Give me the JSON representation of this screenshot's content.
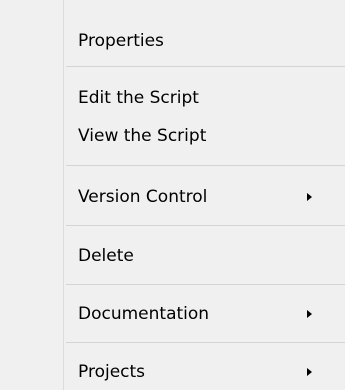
{
  "menu": {
    "items": [
      {
        "label": "Properties",
        "has_submenu": false
      },
      {
        "label": "Edit the Script",
        "has_submenu": false
      },
      {
        "label": "View the Script",
        "has_submenu": false
      },
      {
        "label": "Version Control",
        "has_submenu": true
      },
      {
        "label": "Delete",
        "has_submenu": false
      },
      {
        "label": "Documentation",
        "has_submenu": true
      },
      {
        "label": "Projects",
        "has_submenu": true
      }
    ]
  },
  "colors": {
    "background": "#f0f0f0",
    "text": "#000000",
    "separator": "#d4d4d4"
  }
}
